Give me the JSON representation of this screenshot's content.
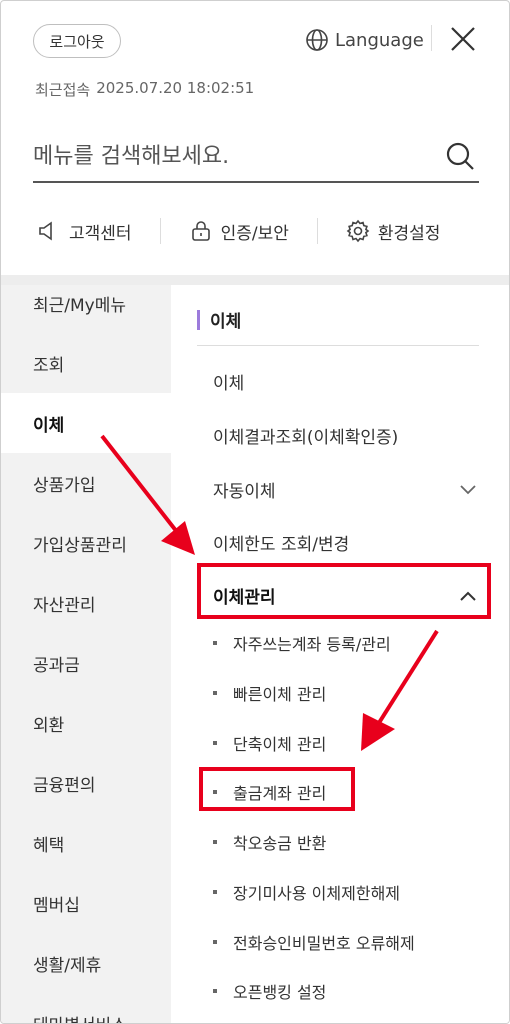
{
  "header": {
    "logout_label": "로그아웃",
    "language_label": "Language",
    "last_login_label": "최근접속",
    "last_login_value": "2025.07.20 18:02:51"
  },
  "search": {
    "placeholder": "메뉴를 검색해보세요."
  },
  "quick_links": [
    {
      "label": "고객센터",
      "icon": "speaker-icon"
    },
    {
      "label": "인증/보안",
      "icon": "lock-icon"
    },
    {
      "label": "환경설정",
      "icon": "gear-icon"
    }
  ],
  "left_menu": [
    "최근/My메뉴",
    "조회",
    "이체",
    "상품가입",
    "가입상품관리",
    "자산관리",
    "공과금",
    "외환",
    "금융편의",
    "혜택",
    "멤버십",
    "생활/제휴",
    "테마별서비스"
  ],
  "left_menu_active": "이체",
  "right": {
    "section_title": "이체",
    "items": [
      "이체",
      "이체결과조회(이체확인증)",
      "자동이체",
      "이체한도 조회/변경",
      "이체관리"
    ],
    "sub_items": [
      "자주쓰는계좌 등록/관리",
      "빠른이체 관리",
      "단축이체 관리",
      "출금계좌 관리",
      "착오송금 반환",
      "장기미사용 이체제한해제",
      "전화승인비밀번호 오류해제",
      "오픈뱅킹 설정"
    ]
  },
  "colors": {
    "accent": "#9c7bdc",
    "highlight": "#e8001c"
  }
}
